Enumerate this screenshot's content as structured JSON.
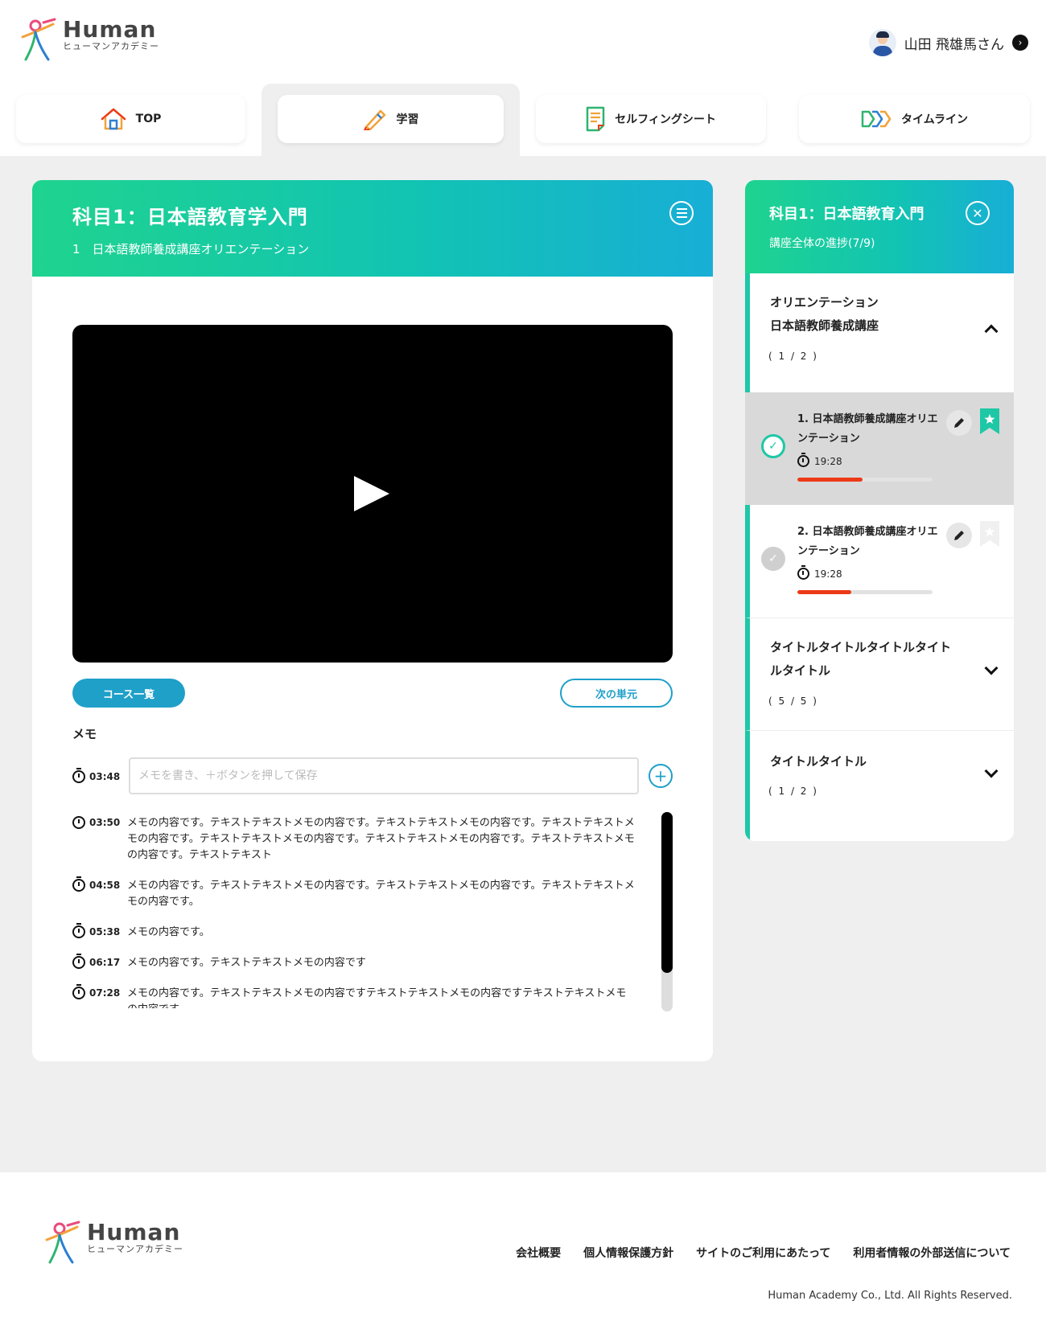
{
  "header": {
    "logo_brand": "Human",
    "logo_sub": "ヒューマンアカデミー",
    "user_name": "山田 飛雄馬さん"
  },
  "nav": {
    "tabs": [
      {
        "label": "TOP",
        "icon": "house-icon"
      },
      {
        "label": "学習",
        "icon": "pencil-icon",
        "active": true
      },
      {
        "label": "セルフィングシート",
        "icon": "document-icon"
      },
      {
        "label": "タイムライン",
        "icon": "timeline-icon"
      }
    ]
  },
  "lesson": {
    "title": "科目1：日本語教育学入門",
    "subtitle": "1　日本語教師養成講座オリエンテーション",
    "course_list_label": "コース一覧",
    "next_unit_label": "次の単元"
  },
  "memo": {
    "heading": "メモ",
    "current_time": "03:48",
    "placeholder": "メモを書き、＋ボタンを押して保存",
    "items": [
      {
        "time": "03:50",
        "text": "メモの内容です。テキストテキストメモの内容です。テキストテキストメモの内容です。テキストテキストメモの内容です。テキストテキストメモの内容です。テキストテキストメモの内容です。テキストテキストメモの内容です。テキストテキスト"
      },
      {
        "time": "04:58",
        "text": "メモの内容です。テキストテキストメモの内容です。テキストテキストメモの内容です。テキストテキストメモの内容です。"
      },
      {
        "time": "05:38",
        "text": "メモの内容です。"
      },
      {
        "time": "06:17",
        "text": "メモの内容です。テキストテキストメモの内容です"
      },
      {
        "time": "07:28",
        "text": "メモの内容です。テキストテキストメモの内容ですテキストテキストメモの内容ですテキストテキストメモの内容です"
      }
    ]
  },
  "side": {
    "title": "科目1：日本語教育入門",
    "progress_text": "講座全体の進捗(7/9)",
    "sections": [
      {
        "title_line1": "オリエンテーション",
        "title_line2": "日本語教師養成講座",
        "count": "( 1 / 2 )"
      },
      {
        "title_line1": "タイトルタイトルタイトルタイト",
        "title_line2": "ルタイトル",
        "count": "( 5 / 5 )"
      },
      {
        "title_line1": "タイトルタイトル",
        "count": "( 1 / 2 )"
      }
    ],
    "lessons": [
      {
        "title": "1. 日本語教師養成講座オリエンテーション",
        "duration": "19:28",
        "progress": 0.48,
        "completed": true,
        "bookmarked": true
      },
      {
        "title": "2. 日本語教師養成講座オリエンテーション",
        "duration": "19:28",
        "progress": 0.4,
        "completed": false,
        "bookmarked": false
      }
    ]
  },
  "footer": {
    "links": [
      "会社概要",
      "個人情報保護方針",
      "サイトのご利用にあたって",
      "利用者情報の外部送信について"
    ],
    "copyright": "Human Academy Co., Ltd. All Rights Reserved."
  },
  "colors": {
    "accent": "#1ea0c9",
    "teal": "#1ec8a6",
    "progress": "#ec3a17",
    "gradient_start": "#1fd38f",
    "gradient_end": "#18aed6"
  }
}
